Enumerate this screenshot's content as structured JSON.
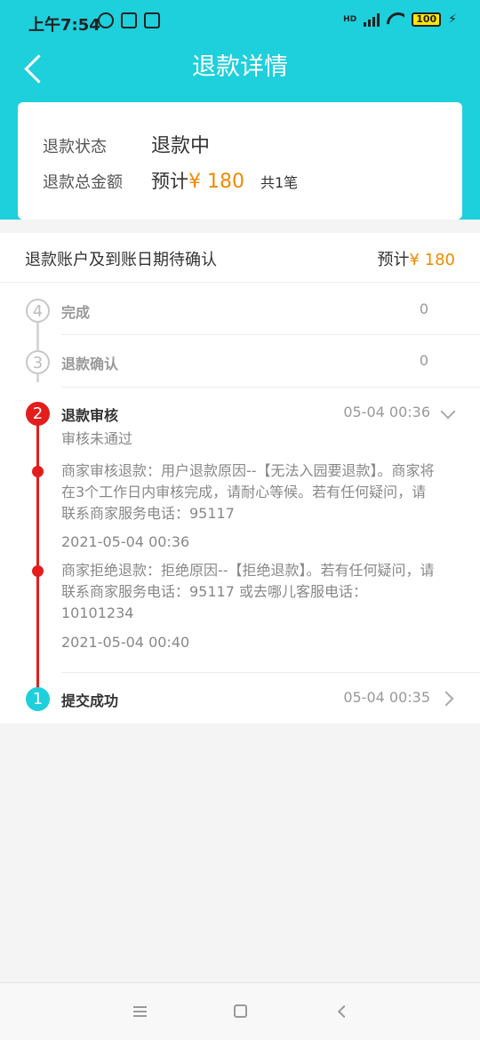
{
  "status_bar": {
    "time": "上午7:54",
    "network_label": "HD",
    "battery_level": "100",
    "icons": [
      "alarm-icon",
      "trash-icon",
      "message-icon",
      "signal-icon",
      "wifi-icon",
      "battery-icon",
      "charging-icon"
    ]
  },
  "header": {
    "title": "退款详情",
    "background": "#1ecfdc"
  },
  "summary": {
    "status_label": "退款状态",
    "status_value": "退款中",
    "total_label": "退款总金额",
    "estimate_prefix": "预计",
    "amount": "¥ 180",
    "count": "共1笔"
  },
  "pending": {
    "label": "退款账户及到账日期待确认",
    "estimate_prefix": "预计",
    "amount": "¥ 180"
  },
  "steps": [
    {
      "number": "4",
      "title": "完成",
      "value": "0"
    },
    {
      "number": "3",
      "title": "退款确认",
      "value": "0"
    },
    {
      "number": "2",
      "title": "退款审核",
      "time": "05-04 00:36",
      "sub_status": "审核未通过",
      "logs": [
        {
          "text": "商家审核退款：用户退款原因--【无法入园要退款】。商家将在3个工作日内审核完成，请耐心等候。若有任何疑问，请联系商家服务电话：95117",
          "time": "2021-05-04 00:36"
        },
        {
          "text": "商家拒绝退款：拒绝原因--【拒绝退款】。若有任何疑问，请联系商家服务电话：95117 或去哪儿客服电话：10101234",
          "time": "2021-05-04 00:40"
        }
      ]
    },
    {
      "number": "1",
      "title": "提交成功",
      "time": "05-04 00:35"
    }
  ],
  "colors": {
    "accent": "#1ecfdc",
    "amount": "#f08a00",
    "timeline_active": "#e51c1c"
  }
}
